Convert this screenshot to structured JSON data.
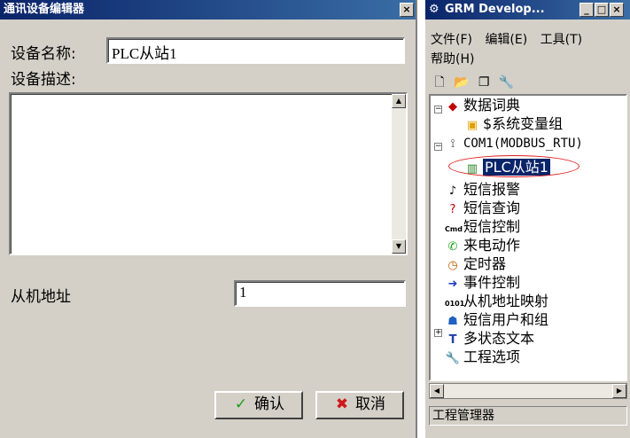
{
  "dialog": {
    "title": "通讯设备编辑器",
    "close": "×",
    "name_label": "设备名称:",
    "name_value": "PLC从站1",
    "desc_label": "设备描述:",
    "slave_label": "从机地址",
    "slave_value": "1",
    "ok_label": "确认",
    "cancel_label": "取消"
  },
  "manager": {
    "title": "GRM Develop...",
    "min": "_",
    "max": "□",
    "close": "×",
    "menu": [
      "文件(F)",
      "编辑(E)",
      "工具(T)",
      "帮助(H)"
    ],
    "tree": [
      {
        "label": "数据词典",
        "icon": "book-icon",
        "glyph": "◆",
        "color": "#c00000"
      },
      {
        "label": "$系统变量组",
        "icon": "folder-icon",
        "glyph": "▣",
        "color": "#e0a000"
      },
      {
        "label": "COM1(MODBUS_RTU)",
        "icon": "plug-icon",
        "glyph": "⟟",
        "color": "#404040"
      },
      {
        "label": "PLC从站1",
        "icon": "device-icon",
        "glyph": "▥",
        "color": "#208020"
      },
      {
        "label": "短信报警",
        "icon": "bell-icon",
        "glyph": "♪",
        "color": "#202020"
      },
      {
        "label": "短信查询",
        "icon": "query-icon",
        "glyph": "?",
        "color": "#c00000"
      },
      {
        "label": "短信控制",
        "icon": "cmd-icon",
        "glyph": "Cmd",
        "color": "#000000"
      },
      {
        "label": "来电动作",
        "icon": "phone-icon",
        "glyph": "✆",
        "color": "#20a020"
      },
      {
        "label": "定时器",
        "icon": "clock-icon",
        "glyph": "◷",
        "color": "#c06000"
      },
      {
        "label": "事件控制",
        "icon": "event-icon",
        "glyph": "➜",
        "color": "#2040c0"
      },
      {
        "label": "从机地址映射",
        "icon": "binary-icon",
        "glyph": "0101",
        "color": "#000000"
      },
      {
        "label": "短信用户和组",
        "icon": "users-icon",
        "glyph": "☗",
        "color": "#2060c0"
      },
      {
        "label": "多状态文本",
        "icon": "text-icon",
        "glyph": "T",
        "color": "#2040a0"
      },
      {
        "label": "工程选项",
        "icon": "wrench-icon",
        "glyph": "🔧",
        "color": "#606060"
      }
    ],
    "status": "工程管理器"
  }
}
